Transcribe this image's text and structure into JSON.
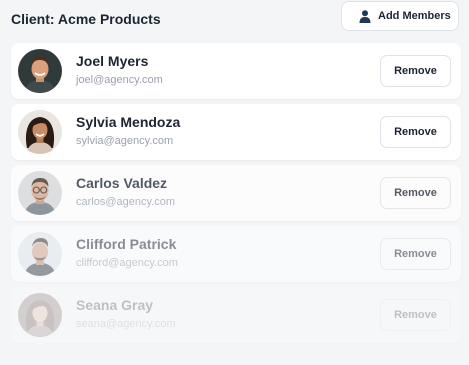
{
  "header": {
    "title": "Client: Acme Products",
    "add_members_label": "Add Members",
    "add_members_icon": "user-icon"
  },
  "members": [
    {
      "name": "Joel Myers",
      "email": "joel@agency.com",
      "remove_label": "Remove",
      "opacity": 1.0
    },
    {
      "name": "Sylvia Mendoza",
      "email": "sylvia@agency.com",
      "remove_label": "Remove",
      "opacity": 1.0
    },
    {
      "name": "Carlos Valdez",
      "email": "carlos@agency.com",
      "remove_label": "Remove",
      "opacity": 0.75
    },
    {
      "name": "Clifford Patrick",
      "email": "clifford@agency.com",
      "remove_label": "Remove",
      "opacity": 0.5
    },
    {
      "name": "Seana Gray",
      "email": "seana@agency.com",
      "remove_label": "Remove",
      "opacity": 0.25
    }
  ],
  "colors": {
    "background": "#f4f5f7",
    "card": "#ffffff",
    "text_primary": "#1d2433",
    "text_secondary": "#9aa1ad",
    "border": "#dfe2e8",
    "accent_icon": "#1f3a52"
  }
}
